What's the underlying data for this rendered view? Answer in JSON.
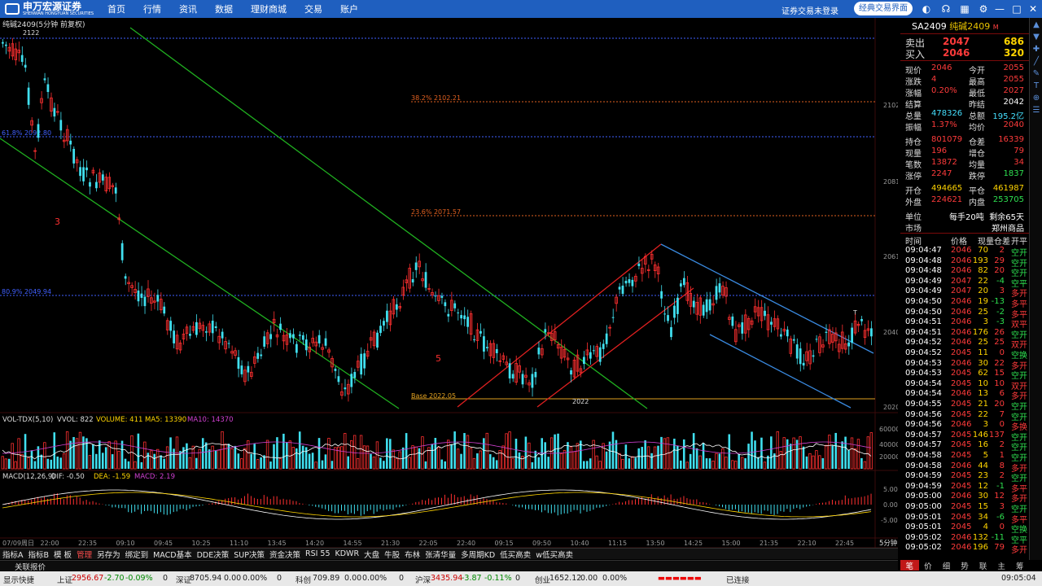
{
  "topbar": {
    "logo_text": "申万宏源证券",
    "logo_sub": "SHENWAN HONGYUAN SECURITIES",
    "menu": [
      "首页",
      "行情",
      "资讯",
      "数据",
      "理财商城",
      "交易",
      "账户"
    ],
    "account_status": "证券交易未登录",
    "classic_btn": "经典交易界面"
  },
  "chart": {
    "title": "纯碱2409(5分钟 前复权)",
    "top_val": "2122",
    "fib": [
      {
        "label": "38.2% 2102.21"
      },
      {
        "label": "61.8% 2092.80"
      },
      {
        "label": "23.6% 2071.57"
      },
      {
        "label": "80.9% 2049.94"
      },
      {
        "label": "Base 2022.05"
      }
    ],
    "low_mark": "2022",
    "wave3": "3",
    "wave5": "5",
    "t_mark": "T",
    "axis": [
      "2102",
      "2081",
      "2061",
      "2040",
      "2020"
    ],
    "vol": {
      "name": "VOL-TDX(5,10)",
      "vvol": "VVOL: 822",
      "volume": "VOLUME: 411",
      "ma5": "MA5: 13390",
      "ma10": "MA10: 14370",
      "ticks": [
        "60000",
        "40000",
        "20000"
      ]
    },
    "macd": {
      "name": "MACD(12,26,9)",
      "dif": "DIF: -0.50",
      "dea": "DEA: -1.59",
      "macd": "MACD: 2.19",
      "ticks": [
        "5.00",
        "0.00",
        "-5.00"
      ]
    },
    "times": [
      "07/09周日",
      "22:00",
      "22:35",
      "09:10",
      "09:45",
      "10:25",
      "11:10",
      "13:45",
      "14:20",
      "14:55",
      "21:30",
      "22:05",
      "22:40",
      "09:15",
      "09:50",
      "10:40",
      "11:15",
      "13:50",
      "14:25",
      "15:00",
      "21:35",
      "22:10",
      "22:45"
    ],
    "period": "5分钟"
  },
  "quote": {
    "code": "SA2409",
    "name": "纯碱2409",
    "m": "M",
    "ask": {
      "label": "卖出",
      "price": "2047",
      "vol": "686"
    },
    "bid": {
      "label": "买入",
      "price": "2046",
      "vol": "320"
    },
    "rows1": [
      [
        "现价",
        "2046",
        "今开",
        "2055"
      ],
      [
        "涨跌",
        "4",
        "最高",
        "2055"
      ],
      [
        "涨幅",
        "0.20%",
        "最低",
        "2027"
      ],
      [
        "结算",
        "",
        "昨结",
        "2042"
      ],
      [
        "总量",
        "478326",
        "总额",
        "195.2亿"
      ],
      [
        "振幅",
        "1.37%",
        "均价",
        "2040"
      ]
    ],
    "rows2": [
      [
        "持仓",
        "801079",
        "仓差",
        "16339"
      ],
      [
        "现量",
        "196",
        "增仓",
        "79"
      ],
      [
        "笔数",
        "13872",
        "均量",
        "34"
      ],
      [
        "涨停",
        "2247",
        "跌停",
        "1837"
      ]
    ],
    "rows3": [
      [
        "开仓",
        "494665",
        "平仓",
        "461987"
      ],
      [
        "外盘",
        "224621",
        "内盘",
        "253705"
      ]
    ],
    "unit": {
      "label": "单位",
      "value": "每手20吨",
      "remain": "剩余65天"
    },
    "market": {
      "label": "市场",
      "value": "郑州商品"
    },
    "tick_headers": [
      "时间",
      "价格",
      "现量",
      "仓差",
      "开平"
    ],
    "ticks": [
      [
        "09:04:47",
        "2046",
        "70",
        "2",
        "空开"
      ],
      [
        "09:04:48",
        "2046",
        "193",
        "29",
        "空开"
      ],
      [
        "09:04:48",
        "2046",
        "82",
        "20",
        "空开"
      ],
      [
        "09:04:49",
        "2047",
        "22",
        "-4",
        "空平"
      ],
      [
        "09:04:49",
        "2047",
        "20",
        "3",
        "多开"
      ],
      [
        "09:04:50",
        "2046",
        "19",
        "-13",
        "多平"
      ],
      [
        "09:04:50",
        "2046",
        "25",
        "-2",
        "多平"
      ],
      [
        "09:04:51",
        "2046",
        "3",
        "-3",
        "双平"
      ],
      [
        "09:04:51",
        "2046",
        "176",
        "26",
        "空开"
      ],
      [
        "09:04:52",
        "2046",
        "25",
        "25",
        "双开"
      ],
      [
        "09:04:52",
        "2045",
        "11",
        "0",
        "空换"
      ],
      [
        "09:04:53",
        "2046",
        "30",
        "22",
        "多开"
      ],
      [
        "09:04:53",
        "2045",
        "62",
        "15",
        "空开"
      ],
      [
        "09:04:54",
        "2045",
        "10",
        "10",
        "双开"
      ],
      [
        "09:04:54",
        "2046",
        "13",
        "6",
        "多开"
      ],
      [
        "09:04:55",
        "2045",
        "21",
        "20",
        "空开"
      ],
      [
        "09:04:56",
        "2045",
        "22",
        "7",
        "空开"
      ],
      [
        "09:04:56",
        "2046",
        "3",
        "0",
        "多换"
      ],
      [
        "09:04:57",
        "2045",
        "146",
        "137",
        "空开"
      ],
      [
        "09:04:57",
        "2045",
        "16",
        "2",
        "空开"
      ],
      [
        "09:04:58",
        "2045",
        "5",
        "1",
        "空开"
      ],
      [
        "09:04:58",
        "2046",
        "44",
        "8",
        "多开"
      ],
      [
        "09:04:59",
        "2045",
        "23",
        "2",
        "空开"
      ],
      [
        "09:04:59",
        "2045",
        "12",
        "-1",
        "多平"
      ],
      [
        "09:05:00",
        "2046",
        "30",
        "12",
        "多开"
      ],
      [
        "09:05:00",
        "2045",
        "15",
        "3",
        "空开"
      ],
      [
        "09:05:01",
        "2045",
        "34",
        "-6",
        "多平"
      ],
      [
        "09:05:01",
        "2045",
        "4",
        "0",
        "空换"
      ],
      [
        "09:05:02",
        "2046",
        "132",
        "-11",
        "空平"
      ],
      [
        "09:05:02",
        "2046",
        "196",
        "79",
        "多开"
      ]
    ],
    "tabs": [
      "笔",
      "价",
      "细",
      "势",
      "联",
      "主",
      "筹"
    ]
  },
  "tabbar": [
    "指标A",
    "指标B",
    "模 板",
    "管理",
    "另存为",
    "绑定到",
    "MACD基本",
    "DDE决策",
    "SUP决策",
    "资金决策",
    "RSI 55",
    "KDWR",
    "大盘",
    "牛股",
    "布林",
    "张清华量",
    "多周期KD",
    "低买高卖",
    "w低买高卖"
  ],
  "relbar": "关联报价",
  "status": {
    "quick": "显示快捷",
    "sh": {
      "name": "上证",
      "val": "2956.67",
      "chg": "-2.70",
      "pct": "-0.09%",
      "n": "0"
    },
    "sz": {
      "name": "深证",
      "val": "8705.94",
      "chg": "0.00",
      "pct": "0.00%",
      "n": "0"
    },
    "kc": {
      "name": "科创",
      "val": "709.89",
      "chg": "0.00",
      "pct": "0.00%",
      "n": "0"
    },
    "hs": {
      "name": "沪深",
      "val": "3435.94",
      "chg": "-3.87",
      "pct": "-0.11%",
      "n": "0"
    },
    "cy": {
      "name": "创业",
      "val": "1652.12",
      "chg": "0.00",
      "pct": "0.00%"
    },
    "conn": "已连接",
    "time": "09:05:04"
  }
}
